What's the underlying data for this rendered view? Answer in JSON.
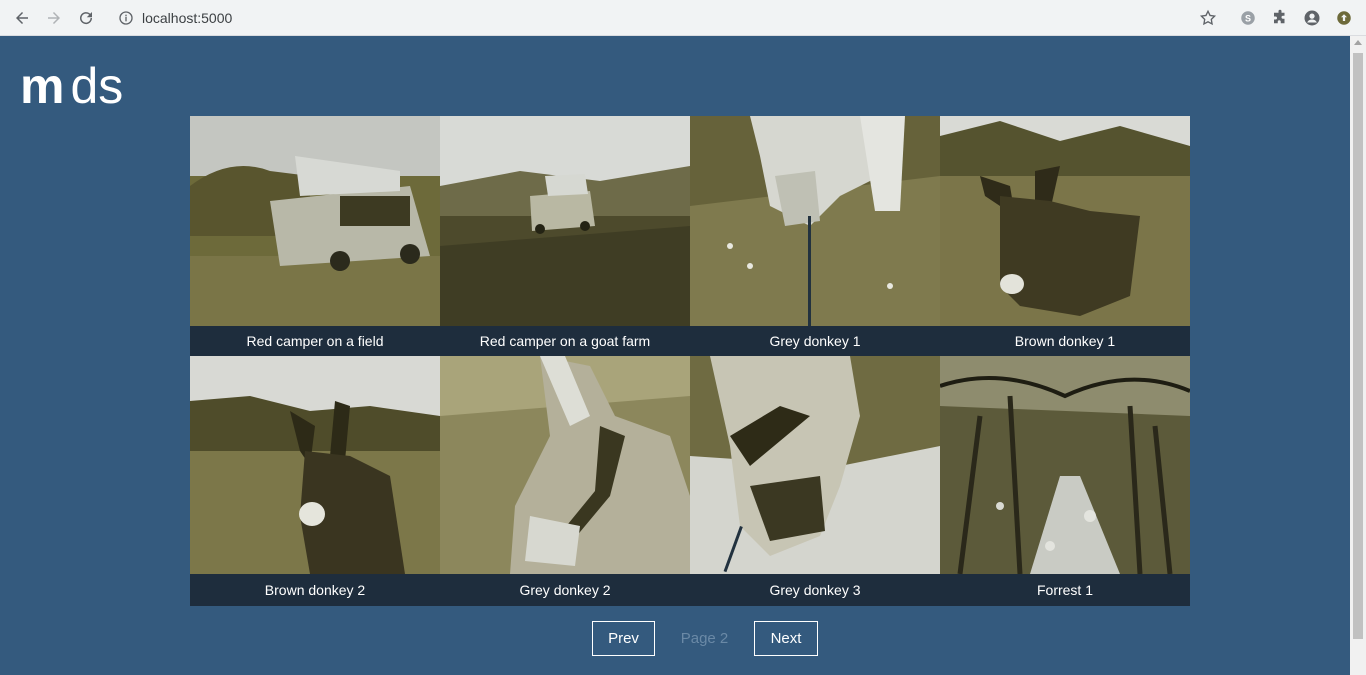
{
  "browser": {
    "url": "localhost:5000"
  },
  "site": {
    "logo_bold": "m",
    "logo_rest": "ds"
  },
  "gallery": {
    "items": [
      {
        "caption": "Red camper on a field"
      },
      {
        "caption": "Red camper on a goat farm"
      },
      {
        "caption": "Grey donkey 1"
      },
      {
        "caption": "Brown donkey 1"
      },
      {
        "caption": "Brown donkey 2"
      },
      {
        "caption": "Grey donkey 2"
      },
      {
        "caption": "Grey donkey 3"
      },
      {
        "caption": "Forrest 1"
      }
    ]
  },
  "pager": {
    "prev_label": "Prev",
    "page_label": "Page 2",
    "next_label": "Next"
  },
  "colors": {
    "page_bg": "#345a7e",
    "caption_bg": "#1e2d3d",
    "disabled_text": "#6a89a6"
  }
}
